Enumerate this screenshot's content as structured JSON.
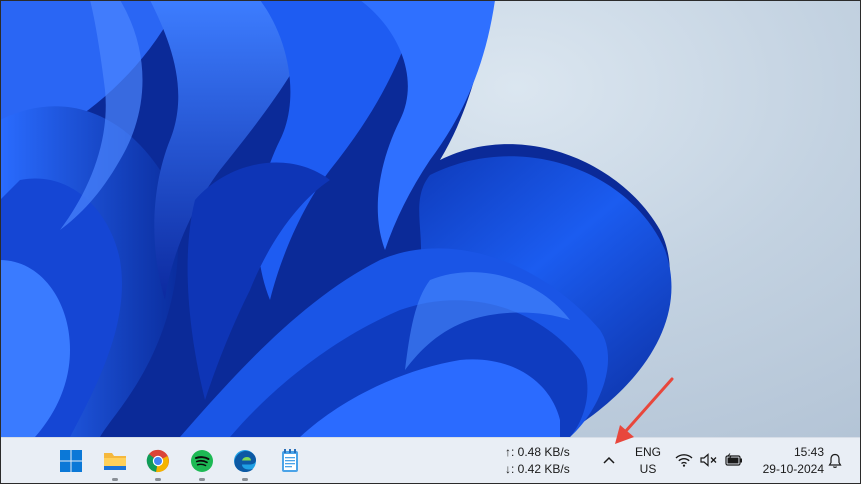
{
  "taskbar": {
    "apps": [
      {
        "name": "start",
        "icon": "windows-logo-icon"
      },
      {
        "name": "file-explorer",
        "icon": "folder-icon"
      },
      {
        "name": "chrome",
        "icon": "chrome-icon"
      },
      {
        "name": "spotify",
        "icon": "spotify-icon"
      },
      {
        "name": "edge",
        "icon": "edge-icon"
      },
      {
        "name": "notepad",
        "icon": "notepad-icon"
      }
    ],
    "network_speed": {
      "upload": "↑: 0.48 KB/s",
      "download": "↓: 0.42 KB/s"
    },
    "overflow_chevron": "^",
    "language": {
      "line1": "ENG",
      "line2": "US"
    },
    "clock": {
      "time": "15:43",
      "date": "29-10-2024"
    }
  },
  "colors": {
    "taskbar_bg": "#e9eef5",
    "wallpaper_bloom": "#1a4fd6",
    "annotation_arrow": "#e8473c"
  }
}
